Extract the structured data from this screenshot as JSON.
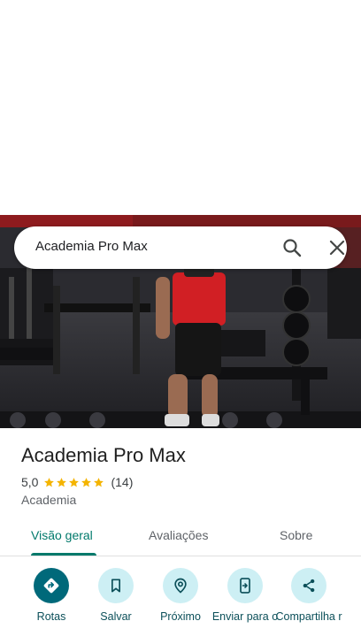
{
  "search": {
    "query": "Academia Pro Max"
  },
  "place": {
    "name": "Academia Pro Max",
    "rating": "5,0",
    "stars": 5,
    "review_count": "(14)",
    "category": "Academia"
  },
  "tabs": [
    {
      "label": "Visão geral",
      "active": true
    },
    {
      "label": "Avaliações",
      "active": false
    },
    {
      "label": "Sobre",
      "active": false
    }
  ],
  "actions": [
    {
      "label": "Rotas",
      "icon": "directions-icon"
    },
    {
      "label": "Salvar",
      "icon": "bookmark-icon"
    },
    {
      "label": "Próximo",
      "icon": "nearby-icon"
    },
    {
      "label": "Enviar para o",
      "icon": "send-to-phone-icon"
    },
    {
      "label": "Compartilha r",
      "icon": "share-icon"
    }
  ],
  "colors": {
    "accent": "#00796b",
    "action_bg": "#cdeff4",
    "primary_action_bg": "#00697a",
    "star": "#f4b400"
  }
}
